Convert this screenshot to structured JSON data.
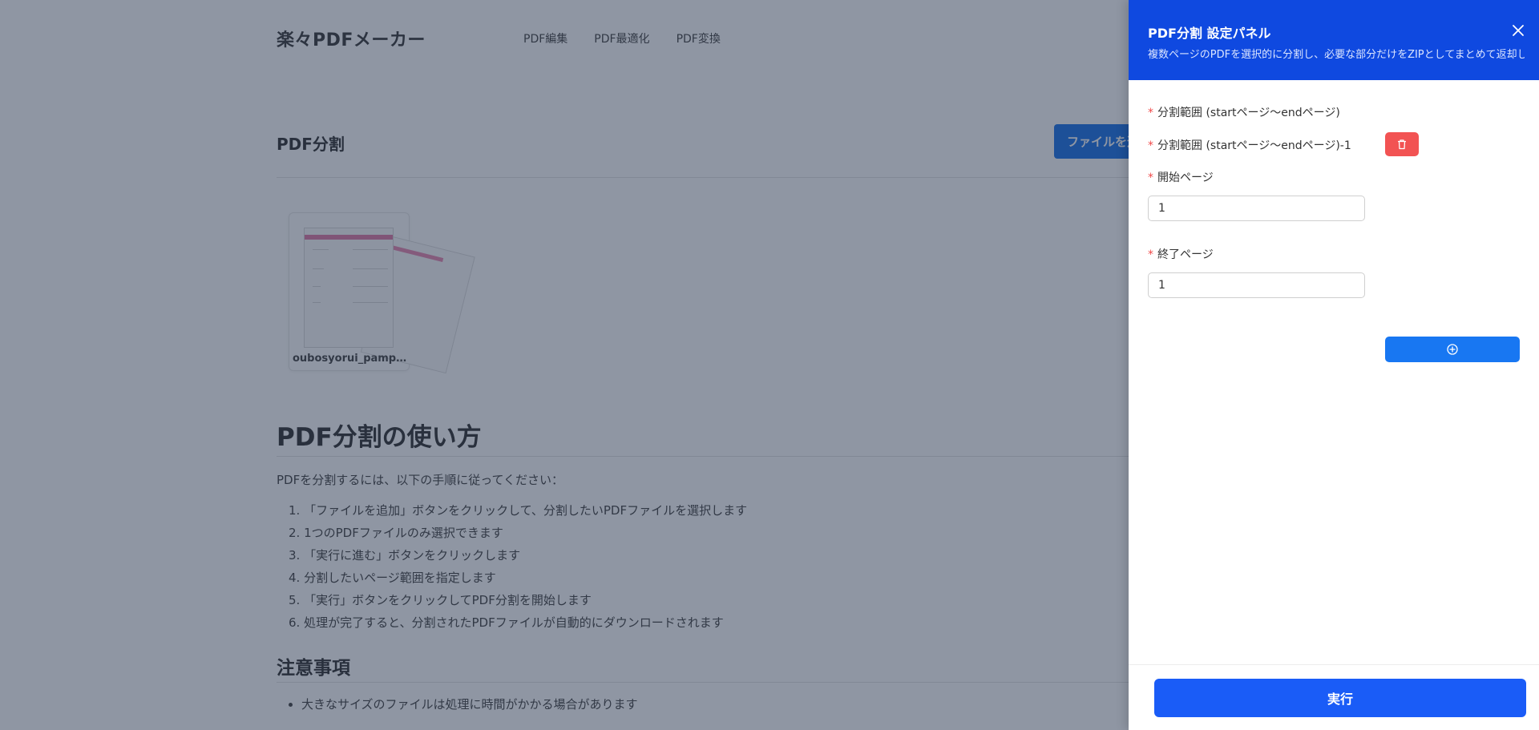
{
  "app": {
    "logo": "楽々PDFメーカー",
    "nav": [
      "PDF編集",
      "PDF最適化",
      "PDF変換"
    ]
  },
  "main": {
    "section_title": "PDF分割",
    "add_file_label": "ファイルを追加",
    "file": {
      "name": "oubosyorui_pamphl..."
    },
    "howto_title": "PDF分割の使い方",
    "intro": "PDFを分割するには、以下の手順に従ってください：",
    "steps": [
      "1. 「ファイルを追加」ボタンをクリックして、分割したいPDFファイルを選択します",
      "2. 1つのPDFファイルのみ選択できます",
      "3. 「実行に進む」ボタンをクリックします",
      "4. 分割したいページ範囲を指定します",
      "5. 「実行」ボタンをクリックしてPDF分割を開始します",
      "6. 処理が完了すると、分割されたPDFファイルが自動的にダウンロードされます"
    ],
    "notes_title": "注意事項",
    "notes": [
      "大きなサイズのファイルは処理に時間がかかる場合があります"
    ]
  },
  "panel": {
    "title": "PDF分割 設定パネル",
    "subtitle": "複数ページのPDFを選択的に分割し、必要な部分だけをZIPとしてまとめて返却します",
    "required_mark": "*",
    "range_group_label": "分割範囲 (startページ〜endページ)",
    "range_item_label": "分割範囲 (startページ〜endページ)-1",
    "start_label": "開始ページ",
    "start_value": "1",
    "end_label": "終了ページ",
    "end_value": "1",
    "run_label": "実行"
  },
  "colors": {
    "panel_header": "#0f49e0",
    "delete_button": "#f25353",
    "primary_button": "#1a5cf7",
    "required": "#f04a4a"
  },
  "icons": {
    "close": "close-icon",
    "delete": "trash-icon",
    "add": "plus-circle-icon"
  }
}
